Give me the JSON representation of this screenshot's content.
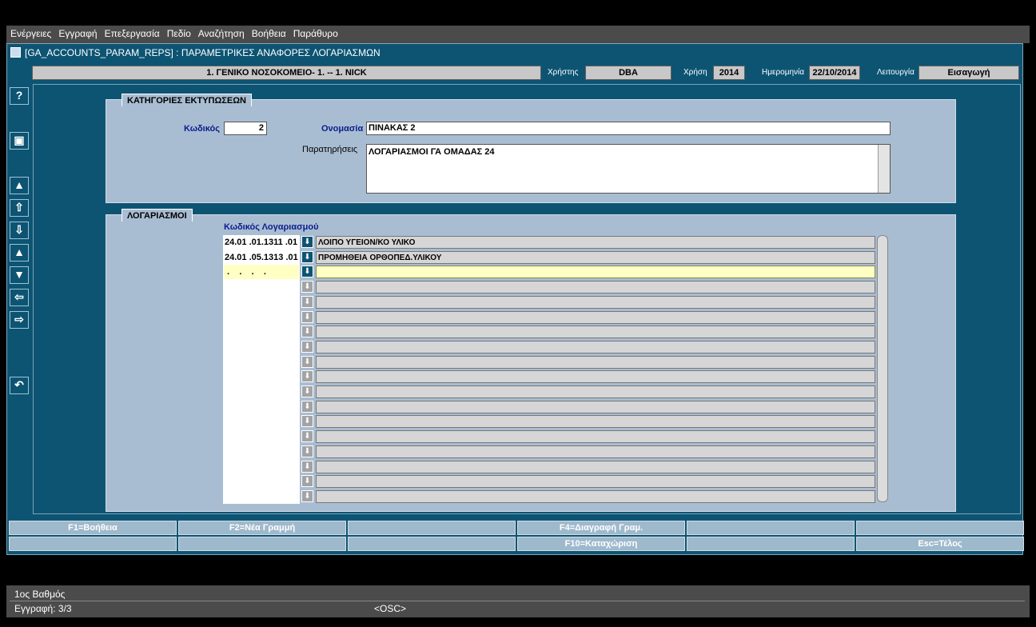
{
  "menu": [
    "Ενέργειες",
    "Εγγραφή",
    "Επεξεργασία",
    "Πεδίο",
    "Αναζήτηση",
    "Βοήθεια",
    "Παράθυρο"
  ],
  "window": {
    "title": "[GA_ACCOUNTS_PARAM_REPS]  :  ΠΑΡΑΜΕΤΡΙΚΕΣ ΑΝΑΦΟΡΕΣ ΛΟΓΑΡΙΑΣΜΩΝ"
  },
  "header": {
    "org": "1. ΓΕΝΙΚΟ ΝΟΣΟΚΟΜΕΙΟ- 1. -- 1. NICK",
    "user_label": "Χρήστης",
    "user": "DBA",
    "year_label": "Χρήση",
    "year": "2014",
    "date_label": "Ημερομηνία",
    "date": "22/10/2014",
    "mode_label": "Λειτουργία",
    "mode": "Εισαγωγή"
  },
  "toolbar_icons": [
    "help-icon",
    "save-icon",
    "delete-icon",
    "first-record-icon",
    "last-record-icon",
    "previous-record-icon",
    "next-record-icon",
    "previous-block-icon",
    "next-block-icon",
    "exit-icon"
  ],
  "categories": {
    "title": "ΚΑΤΗΓΟΡΙΕΣ ΕΚΤΥΠΩΣΕΩΝ",
    "code_label": "Κωδικός",
    "code": "2",
    "name_label": "Ονομασία",
    "name": "ΠΙΝΑΚΑΣ 2",
    "notes_label": "Παρατηρήσεις",
    "notes": "ΛΟΓΑΡΙΑΣΜΟΙ ΓΑ ΟΜΑΔΑΣ 24"
  },
  "accounts": {
    "title": "ΛΟΓΑΡΙΑΣΜΟΙ",
    "column_header": "Κωδικός Λογαριασμού",
    "rows": [
      {
        "code": "24.01 .01.1311 .01",
        "desc": "ΛΟΙΠΟ ΥΓΕΙΟΝ/ΚΟ ΥΛΙΚΟ"
      },
      {
        "code": "24.01 .05.1313 .01",
        "desc": "ΠΡΟΜΗΘΕΙΑ ΟΡΘΟΠΕΔ.ΥΛΙΚΟΥ"
      },
      {
        "code": " .    .    .    .",
        "desc": ""
      },
      {
        "code": "",
        "desc": ""
      },
      {
        "code": "",
        "desc": ""
      },
      {
        "code": "",
        "desc": ""
      },
      {
        "code": "",
        "desc": ""
      },
      {
        "code": "",
        "desc": ""
      },
      {
        "code": "",
        "desc": ""
      },
      {
        "code": "",
        "desc": ""
      },
      {
        "code": "",
        "desc": ""
      },
      {
        "code": "",
        "desc": ""
      },
      {
        "code": "",
        "desc": ""
      },
      {
        "code": "",
        "desc": ""
      },
      {
        "code": "",
        "desc": ""
      },
      {
        "code": "",
        "desc": ""
      },
      {
        "code": "",
        "desc": ""
      },
      {
        "code": "",
        "desc": ""
      }
    ]
  },
  "fkeys": {
    "row1": [
      "F1=Βοήθεια",
      "F2=Νέα Γραμμή",
      "",
      "F4=Διαγραφή Γραμ.",
      "",
      ""
    ],
    "row2": [
      "",
      "",
      "",
      "F10=Καταχώριση",
      "",
      "Esc=Τέλος"
    ]
  },
  "status": {
    "line1": "1ος Βαθμός",
    "record": "Εγγραφή: 3/3",
    "osc": "<OSC>"
  },
  "colors": {
    "window_bg": "#0d5473",
    "panel_bg": "#a9bdd2",
    "active_row": "#ffffc4"
  }
}
